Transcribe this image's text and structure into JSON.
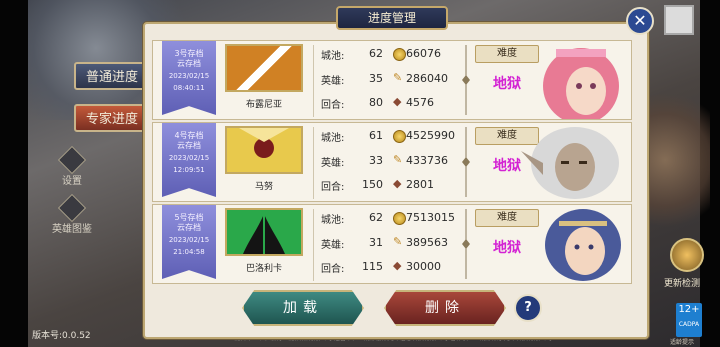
{
  "dialog": {
    "title": "进度管理",
    "close_icon": "close-icon"
  },
  "left_menu": {
    "normal": "普通进度",
    "expert": "专家进度",
    "settings": "设置",
    "heroes": "英雄图鉴"
  },
  "version": "版本号:0.0.52",
  "right_side": {
    "update": "更新检测",
    "age": "12+",
    "age_caption": "CADPA",
    "age_note": "适龄提示"
  },
  "slots": [
    {
      "name": "3号存档",
      "sub": "云存档",
      "date": "2023/02/15",
      "time": "08:40:11",
      "faction": "布露尼亚",
      "flag_colors": [
        "#c97a1e",
        "#ffffff"
      ],
      "city_label": "城池:",
      "city": "62",
      "gold": "66076",
      "hero_label": "英雄:",
      "hero": "35",
      "exp": "286040",
      "round_label": "回合:",
      "round": "80",
      "cards": "4576",
      "difficulty_label": "难度",
      "difficulty": "地狱",
      "portrait": "pink-haired-woman"
    },
    {
      "name": "4号存档",
      "sub": "云存档",
      "date": "2023/02/15",
      "time": "12:09:51",
      "faction": "马努",
      "flag_colors": [
        "#e6c94a",
        "#7a1c1c"
      ],
      "city_label": "城池:",
      "city": "61",
      "gold": "4525990",
      "hero_label": "英雄:",
      "hero": "33",
      "exp": "433736",
      "round_label": "回合:",
      "round": "150",
      "cards": "2801",
      "difficulty_label": "难度",
      "difficulty": "地狱",
      "portrait": "white-haired-elder"
    },
    {
      "name": "5号存档",
      "sub": "云存档",
      "date": "2023/02/15",
      "time": "21:04:58",
      "faction": "巴洛利卡",
      "flag_colors": [
        "#2aaa4a",
        "#1a1a1a"
      ],
      "city_label": "城池:",
      "city": "62",
      "gold": "7513015",
      "hero_label": "英雄:",
      "hero": "31",
      "exp": "389563",
      "round_label": "回合:",
      "round": "115",
      "cards": "30000",
      "difficulty_label": "难度",
      "difficulty": "地狱",
      "portrait": "blue-haired-man"
    }
  ],
  "buttons": {
    "load": "加载",
    "delete": "删除",
    "help": "?"
  },
  "footer": "出版单位：四川数字出版传媒有限公司  运营单位：成都游点光年信息科技有限公司  著作权人：成都点子光年科技有限公司"
}
